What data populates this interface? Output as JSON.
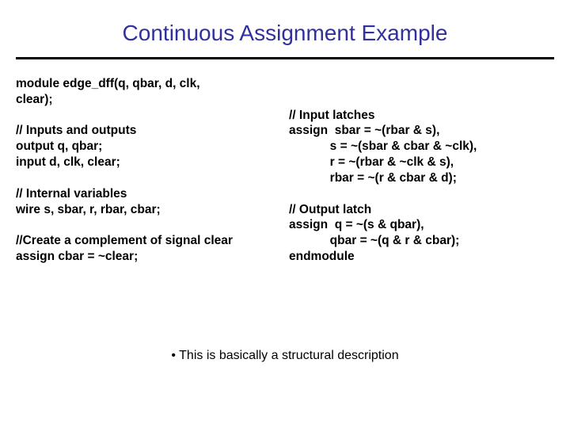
{
  "title": "Continuous Assignment Example",
  "left": {
    "l1": "module edge_dff(q, qbar, d, clk,",
    "l2": "clear);",
    "l3": "",
    "l4": "// Inputs and outputs",
    "l5": "output q, qbar;",
    "l6": "input d, clk, clear;",
    "l7": "",
    "l8": "// Internal variables",
    "l9": "wire s, sbar, r, rbar, cbar;",
    "l10": "",
    "l11": "//Create a complement of signal clear",
    "l12": "assign cbar = ~clear;"
  },
  "right": {
    "r1": "",
    "r2": "",
    "r3": "// Input latches",
    "r4": "assign  sbar = ~(rbar & s),",
    "r5": "            s = ~(sbar & cbar & ~clk),",
    "r6": "            r = ~(rbar & ~clk & s),",
    "r7": "            rbar = ~(r & cbar & d);",
    "r8": "",
    "r9": "// Output latch",
    "r10": "assign  q = ~(s & qbar),",
    "r11": "            qbar = ~(q & r & cbar);",
    "r12": "endmodule"
  },
  "note": "• This is basically a structural description"
}
